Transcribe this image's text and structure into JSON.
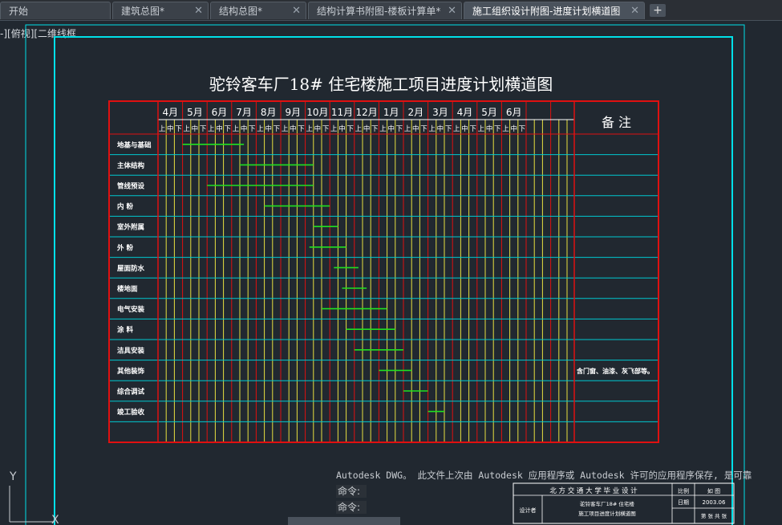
{
  "tabs": [
    {
      "label": "开始",
      "active": false,
      "closable": false
    },
    {
      "label": "建筑总图*",
      "active": false,
      "closable": true
    },
    {
      "label": "结构总图*",
      "active": false,
      "closable": true
    },
    {
      "label": "结构计算书附图-楼板计算单*",
      "active": false,
      "closable": true
    },
    {
      "label": "施工组织设计附图-进度计划横道图",
      "active": true,
      "closable": true
    }
  ],
  "tab_add_label": "+",
  "viewport_label": "-][俯视][二维线框",
  "drawing": {
    "title": "驼铃客车厂18# 住宅楼施工项目进度计划横道图",
    "remarks_header": "备 注",
    "months": [
      "4月",
      "5月",
      "6月",
      "7月",
      "8月",
      "9月",
      "10月",
      "11月",
      "12月",
      "1月",
      "2月",
      "3月",
      "4月",
      "5月",
      "6月"
    ],
    "thirds": [
      "上",
      "中",
      "下"
    ],
    "tasks": [
      {
        "name": "地基与基础",
        "start": 3,
        "end": 10.5
      },
      {
        "name": "主体结构",
        "start": 10,
        "end": 19
      },
      {
        "name": "管线预设",
        "start": 6,
        "end": 19
      },
      {
        "name": "内  粉",
        "start": 13,
        "end": 21
      },
      {
        "name": "室外附属",
        "start": 19,
        "end": 22
      },
      {
        "name": "外  粉",
        "start": 18.5,
        "end": 23
      },
      {
        "name": "屋面防水",
        "start": 21.5,
        "end": 24.5
      },
      {
        "name": "楼地面",
        "start": 22.5,
        "end": 25.5
      },
      {
        "name": "电气安装",
        "start": 20,
        "end": 28
      },
      {
        "name": "涂  料",
        "start": 23,
        "end": 29
      },
      {
        "name": "洁具安装",
        "start": 24,
        "end": 30
      },
      {
        "name": "其他装饰",
        "start": 27,
        "end": 31
      },
      {
        "name": "综合调试",
        "start": 30,
        "end": 33
      },
      {
        "name": "竣工验收",
        "start": 33,
        "end": 35
      }
    ],
    "remark_row_index": 11,
    "remark_text": "含门窗、油漆、灰飞部等。",
    "titleblock": {
      "school": "北 方 交 通 大 学 毕 业 设 计",
      "designer_label": "设计者",
      "project_text1": "驼铃客车厂18# 住宅楼",
      "project_text2": "施工项目进度计划横道图",
      "scale_label": "比例",
      "scale_value": "如 图",
      "date_label": "日期",
      "date_value": "2003.06",
      "sheet_text": "第 张  共 张"
    }
  },
  "command": {
    "history": "Autodesk DWG。  此文件上次由 Autodesk 应用程序或 Autodesk 许可的应用程序保存, 是可靠",
    "prompt_label": "命令:"
  },
  "ucs": {
    "y_label": "Y",
    "x_label": "X"
  },
  "colors": {
    "frame": "#00e0e8",
    "table": "#e01010",
    "grid_lines": "#e8e040",
    "row_lines": "#00c8d0",
    "bars": "#20e020",
    "text": "#ffffff",
    "background": "#212830"
  }
}
